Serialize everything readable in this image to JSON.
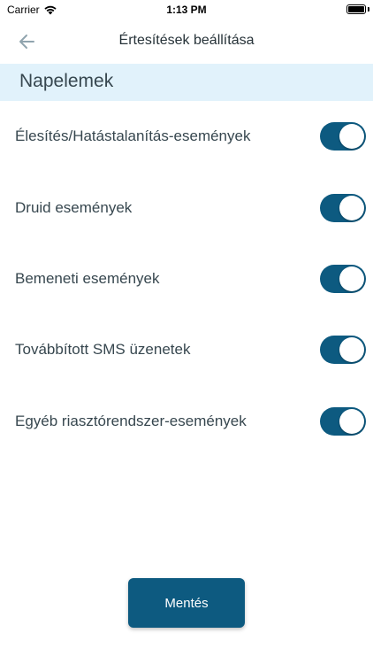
{
  "status_bar": {
    "carrier": "Carrier",
    "time": "1:13 PM"
  },
  "header": {
    "title": "Értesítések beállítása",
    "back_icon": "arrow-left-icon"
  },
  "section": {
    "title": "Napelemek"
  },
  "settings": [
    {
      "label": "Élesítés/Hatástalanítás-események",
      "enabled": true
    },
    {
      "label": "Druid események",
      "enabled": true
    },
    {
      "label": "Bemeneti események",
      "enabled": true
    },
    {
      "label": "Továbbított SMS üzenetek",
      "enabled": true
    },
    {
      "label": "Egyéb riasztórendszer-események",
      "enabled": true
    }
  ],
  "actions": {
    "save_label": "Mentés"
  },
  "colors": {
    "accent": "#0d5a80",
    "section_bg": "#e1f2fb"
  }
}
